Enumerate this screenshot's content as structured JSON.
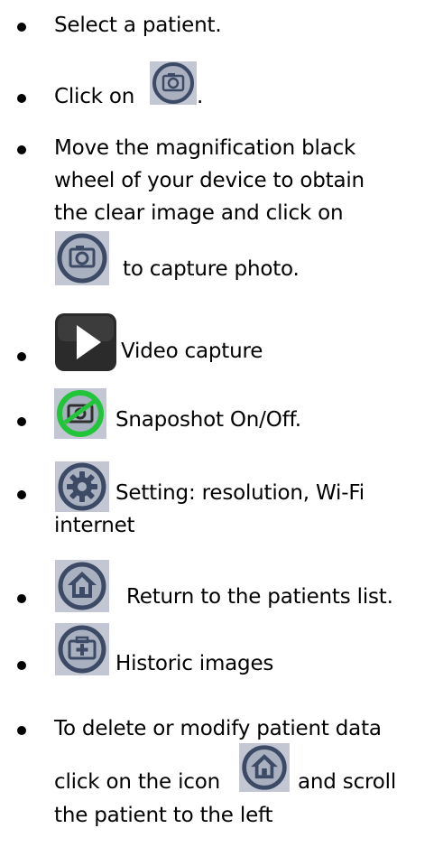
{
  "instructions": [
    {
      "lines": [
        "Select a patient."
      ]
    },
    {
      "before": "Click on",
      "icon": "camera-icon",
      "after": "."
    },
    {
      "lines": [
        "Move the magnification black",
        "wheel of your device  to obtain",
        "the clear  image  and click on"
      ],
      "icon": "camera-icon",
      "after": "to capture photo."
    },
    {
      "icon": "play-icon",
      "text": "Video capture"
    },
    {
      "icon": "snapshot-toggle-icon",
      "text": "Snaposhot On/Off."
    },
    {
      "icon": "settings-icon",
      "text": "Setting: resolution,  Wi-Fi",
      "text2": "internet"
    },
    {
      "icon": "home-icon",
      "text": "Return to the patients list."
    },
    {
      "icon": "history-icon",
      "text": "Historic images"
    },
    {
      "lines": [
        "To delete or modify patient data"
      ],
      "before": "click on the icon",
      "icon": "home-icon",
      "after": "and scroll",
      "text3": "the patient to the left"
    }
  ],
  "colors": {
    "icon_bg": "#a9b0bf",
    "icon_ring": "#3d4a66",
    "snapshot_green": "#22c43a",
    "play_bg": "#2b2b2b"
  }
}
